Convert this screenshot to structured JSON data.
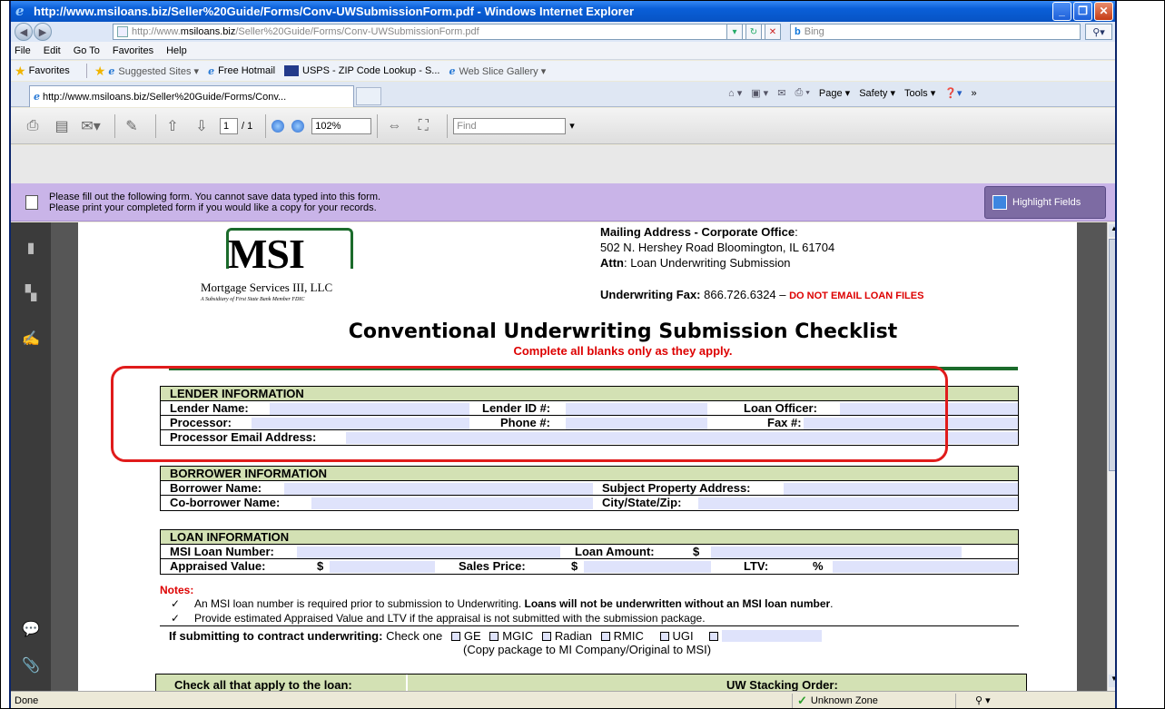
{
  "window": {
    "title": "http://www.msiloans.biz/Seller%20Guide/Forms/Conv-UWSubmissionForm.pdf - Windows Internet Explorer",
    "minimize": "_",
    "maximize": "❐",
    "close": "✕"
  },
  "address": {
    "url_prefix": "http://www.",
    "url_domain": "msiloans.biz",
    "url_path": "/Seller%20Guide/Forms/Conv-UWSubmissionForm.pdf",
    "search_placeholder": "Bing"
  },
  "menu": [
    "File",
    "Edit",
    "Go To",
    "Favorites",
    "Help"
  ],
  "favorites": {
    "label": "Favorites",
    "items": [
      "Suggested Sites ▾",
      "Free Hotmail",
      "USPS - ZIP Code Lookup - S...",
      "Web Slice Gallery ▾"
    ]
  },
  "tab": {
    "title": "http://www.msiloans.biz/Seller%20Guide/Forms/Conv..."
  },
  "commandbar": [
    "Page ▾",
    "Safety ▾",
    "Tools ▾"
  ],
  "pdf_toolbar": {
    "page_current": "1",
    "page_total": "/ 1",
    "zoom": "102%",
    "find_placeholder": "Find"
  },
  "notice": {
    "line1": "Please fill out the following form. You cannot save data typed into this form.",
    "line2": "Please print your completed form if you would like a copy for your records.",
    "button": "Highlight Fields"
  },
  "doc": {
    "logo": "MSI",
    "logo_sub": "Mortgage Services III, LLC",
    "logo_sub2": "A Subsidiary of First State Bank  Member FDIC",
    "addr_title": "Mailing Address - Corporate Office",
    "addr_line": "502 N. Hershey Road Bloomington, IL  61704",
    "attn_label": "Attn",
    "attn_value": ": Loan Underwriting Submission",
    "fax_label": "Underwriting Fax:",
    "fax_value": " 866.726.6324 – ",
    "fax_warning": "DO NOT EMAIL LOAN FILES",
    "title": "Conventional Underwriting Submission Checklist",
    "subtitle": "Complete all blanks only as they apply.",
    "lender": {
      "head": "LENDER INFORMATION",
      "name": "Lender Name:",
      "id": "Lender ID #:",
      "officer": "Loan Officer:",
      "processor": "Processor:",
      "phone": "Phone #:",
      "fax": "Fax #:",
      "email": "Processor Email Address:"
    },
    "borrower": {
      "head": "BORROWER INFORMATION",
      "name": "Borrower Name:",
      "property": "Subject Property Address:",
      "coname": "Co-borrower Name:",
      "city": "City/State/Zip:"
    },
    "loan": {
      "head": "LOAN INFORMATION",
      "number": "MSI Loan Number:",
      "amount": "Loan Amount:",
      "dollar": "$",
      "appraised": "Appraised Value:",
      "sales": "Sales Price:",
      "ltv": "LTV:",
      "pct": "%"
    },
    "notes": {
      "head": "Notes:",
      "n1a": "An MSI loan number is required prior to submission to Underwriting. ",
      "n1b": "Loans will not be underwritten without an MSI loan number",
      "n1c": ".",
      "n2": "Provide estimated Appraised Value and LTV if the appraisal is not submitted with the submission package."
    },
    "contract": {
      "label": "If submitting to contract underwriting:",
      "check": "Check one",
      "opts": [
        "GE",
        "MGIC",
        "Radian",
        "RMIC",
        "UGI"
      ],
      "copy": "(Copy package to MI Company/Original to MSI)"
    },
    "stack": {
      "left": "Check all that apply to the loan:",
      "right": "UW Stacking Order:"
    }
  },
  "status": {
    "left": "Done",
    "zone": "Unknown Zone",
    "zoom": "▾"
  }
}
